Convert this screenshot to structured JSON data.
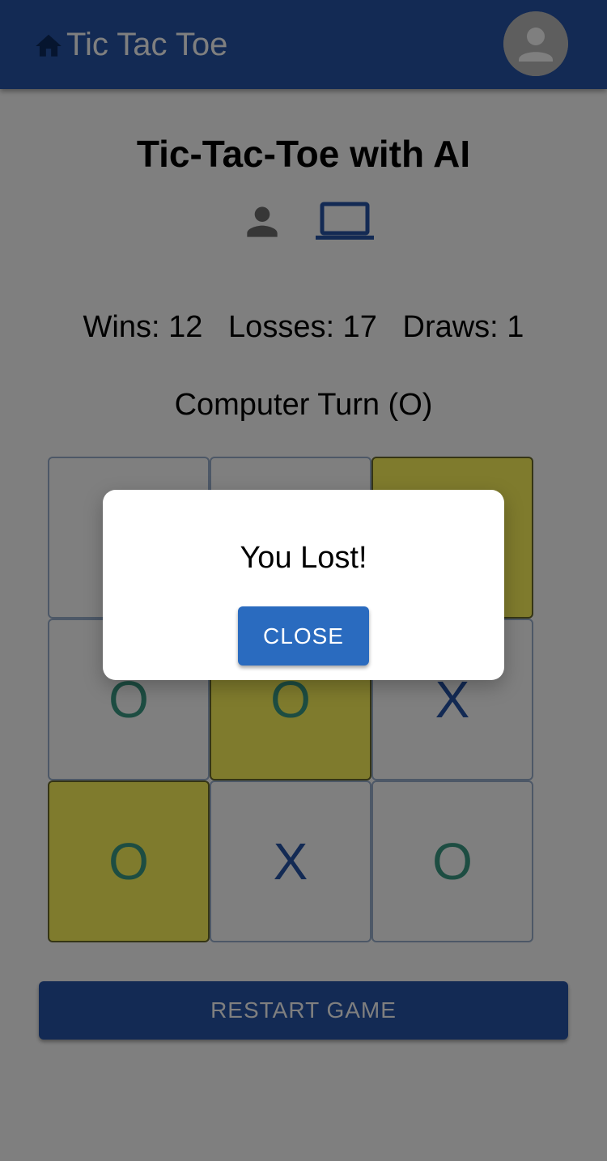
{
  "app_bar": {
    "title": "Tic Tac Toe",
    "icons": {
      "home": "home-icon",
      "account": "account-circle-icon"
    }
  },
  "game": {
    "title": "Tic-Tac-Toe with AI",
    "modes": [
      {
        "name": "person-icon",
        "label": "Two players",
        "active": false
      },
      {
        "name": "computer-icon",
        "label": "Play vs AI",
        "active": true
      }
    ],
    "stats": {
      "wins": 12,
      "losses": 17,
      "draws": 1
    },
    "stats_text": "Wins: 12   Losses: 17   Draws: 1",
    "turn_status": "Computer Turn (O)",
    "board": [
      [
        "",
        "",
        ""
      ],
      [
        "O",
        "O",
        "X"
      ],
      [
        "O",
        "X",
        "O"
      ]
    ],
    "winning_cells": [
      [
        0,
        2
      ],
      [
        1,
        1
      ],
      [
        2,
        0
      ]
    ],
    "restart_label": "RESTART GAME"
  },
  "dialog": {
    "message": "You Lost!",
    "close_label": "CLOSE"
  },
  "colors": {
    "primary": "#2654a8",
    "x_mark": "#2654a8",
    "o_mark": "#3a9a84",
    "win_highlight": "#fff75a"
  }
}
